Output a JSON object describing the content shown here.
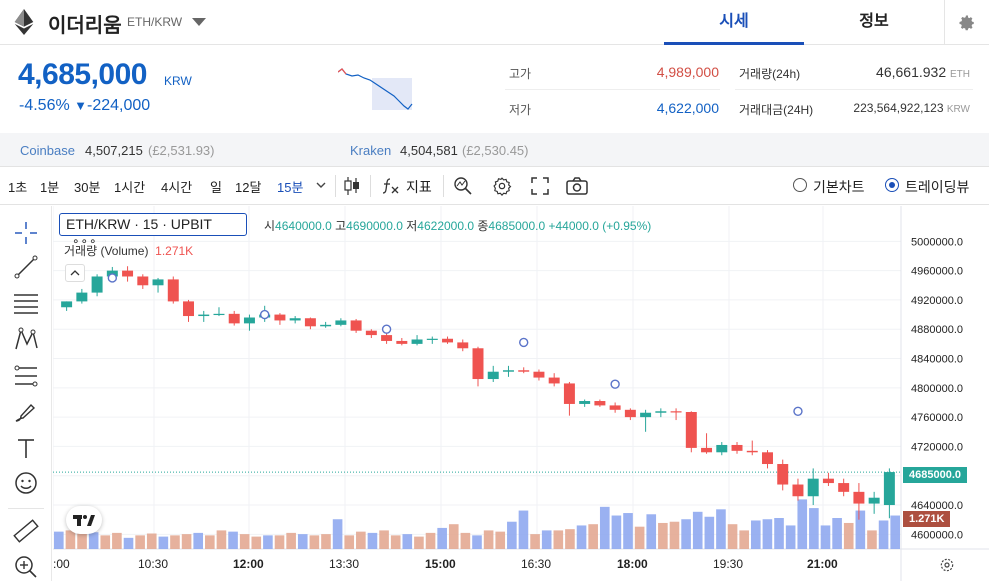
{
  "header": {
    "coin_name": "이더리움",
    "pair": "ETH/KRW",
    "tabs": [
      "시세",
      "정보"
    ]
  },
  "ticker": {
    "price": "4,685,000",
    "currency": "KRW",
    "change_rate": "-4.56%",
    "change_arrow": "▼",
    "change_amount": "-224,000",
    "high_label": "고가",
    "high_value": "4,989,000",
    "low_label": "저가",
    "low_value": "4,622,000",
    "volume_label": "거래량(24h)",
    "volume_value": "46,661.932",
    "volume_unit": "ETH",
    "turnover_label": "거래대금(24H)",
    "turnover_value": "223,564,922,123",
    "turnover_unit": "KRW"
  },
  "exchanges": [
    {
      "name": "Coinbase",
      "price": "4,507,215",
      "sub": "(£2,531.93)"
    },
    {
      "name": "Kraken",
      "price": "4,504,581",
      "sub": "(£2,530.45)"
    }
  ],
  "toolbar": {
    "intervals": [
      "1초",
      "1분",
      "30분",
      "1시간",
      "4시간",
      "일",
      "12달",
      "15분"
    ],
    "indicator_label": "지표",
    "basic_chart": "기본차트",
    "trading_view": "트레이딩뷰"
  },
  "chart_legend": {
    "symbol": "ETH/KRW · 15 · UPBIT",
    "open_label": "시",
    "open": "4640000.0",
    "high_label": "고",
    "high": "4690000.0",
    "low_label": "저",
    "low": "4622000.0",
    "close_label": "종",
    "close": "4685000.0",
    "change": "+44000.0 (+0.95%)",
    "volume_label": "거래량 (Volume)",
    "volume_value": "1.271K",
    "last_price_tag": "4685000.0",
    "volume_tag": "1.271K"
  },
  "colors": {
    "up": "#26a69a",
    "down": "#ef5350",
    "accent": "#1a4fb8",
    "price_blue": "#1261c4",
    "high_red": "#d24f45"
  },
  "chart_data": {
    "type": "candlestick",
    "interval": "15분",
    "y_ticks": [
      "5000000.0",
      "4960000.0",
      "4920000.0",
      "4880000.0",
      "4840000.0",
      "4800000.0",
      "4760000.0",
      "4720000.0",
      "4680000.0",
      "4640000.0",
      "4600000.0"
    ],
    "x_ticks": [
      ":00",
      "10:30",
      "12:00",
      "13:30",
      "15:00",
      "16:30",
      "18:00",
      "19:30",
      "21:00"
    ],
    "ylim": [
      4595000,
      5010000
    ],
    "candles": [
      {
        "o": 4910000,
        "h": 4918000,
        "l": 4905000,
        "c": 4918000
      },
      {
        "o": 4918000,
        "h": 4935000,
        "l": 4915000,
        "c": 4930000
      },
      {
        "o": 4930000,
        "h": 4955000,
        "l": 4925000,
        "c": 4952000
      },
      {
        "o": 4952000,
        "h": 4965000,
        "l": 4945000,
        "c": 4960000
      },
      {
        "o": 4960000,
        "h": 4966000,
        "l": 4945000,
        "c": 4952000
      },
      {
        "o": 4952000,
        "h": 4955000,
        "l": 4935000,
        "c": 4940000
      },
      {
        "o": 4940000,
        "h": 4950000,
        "l": 4930000,
        "c": 4948000
      },
      {
        "o": 4948000,
        "h": 4952000,
        "l": 4915000,
        "c": 4918000
      },
      {
        "o": 4918000,
        "h": 4920000,
        "l": 4890000,
        "c": 4898000
      },
      {
        "o": 4898000,
        "h": 4905000,
        "l": 4890000,
        "c": 4900000
      },
      {
        "o": 4900000,
        "h": 4910000,
        "l": 4898000,
        "c": 4901000
      },
      {
        "o": 4901000,
        "h": 4905000,
        "l": 4885000,
        "c": 4888000
      },
      {
        "o": 4888000,
        "h": 4900000,
        "l": 4878000,
        "c": 4896000
      },
      {
        "o": 4896000,
        "h": 4912000,
        "l": 4890000,
        "c": 4900000
      },
      {
        "o": 4900000,
        "h": 4902000,
        "l": 4886000,
        "c": 4892000
      },
      {
        "o": 4892000,
        "h": 4898000,
        "l": 4888000,
        "c": 4895000
      },
      {
        "o": 4895000,
        "h": 4896000,
        "l": 4880000,
        "c": 4884000
      },
      {
        "o": 4884000,
        "h": 4890000,
        "l": 4882000,
        "c": 4886000
      },
      {
        "o": 4886000,
        "h": 4895000,
        "l": 4884000,
        "c": 4892000
      },
      {
        "o": 4892000,
        "h": 4894000,
        "l": 4875000,
        "c": 4878000
      },
      {
        "o": 4878000,
        "h": 4880000,
        "l": 4868000,
        "c": 4872000
      },
      {
        "o": 4872000,
        "h": 4876000,
        "l": 4860000,
        "c": 4864000
      },
      {
        "o": 4864000,
        "h": 4868000,
        "l": 4858000,
        "c": 4860000
      },
      {
        "o": 4860000,
        "h": 4872000,
        "l": 4858000,
        "c": 4866000
      },
      {
        "o": 4866000,
        "h": 4870000,
        "l": 4860000,
        "c": 4867000
      },
      {
        "o": 4867000,
        "h": 4870000,
        "l": 4860000,
        "c": 4862000
      },
      {
        "o": 4862000,
        "h": 4866000,
        "l": 4850000,
        "c": 4854000
      },
      {
        "o": 4854000,
        "h": 4856000,
        "l": 4802000,
        "c": 4812000
      },
      {
        "o": 4812000,
        "h": 4830000,
        "l": 4808000,
        "c": 4822000
      },
      {
        "o": 4822000,
        "h": 4830000,
        "l": 4815000,
        "c": 4824000
      },
      {
        "o": 4824000,
        "h": 4828000,
        "l": 4820000,
        "c": 4822000
      },
      {
        "o": 4822000,
        "h": 4825000,
        "l": 4810000,
        "c": 4814000
      },
      {
        "o": 4814000,
        "h": 4820000,
        "l": 4802000,
        "c": 4806000
      },
      {
        "o": 4806000,
        "h": 4808000,
        "l": 4762000,
        "c": 4778000
      },
      {
        "o": 4778000,
        "h": 4784000,
        "l": 4774000,
        "c": 4782000
      },
      {
        "o": 4782000,
        "h": 4784000,
        "l": 4774000,
        "c": 4776000
      },
      {
        "o": 4776000,
        "h": 4780000,
        "l": 4766000,
        "c": 4770000
      },
      {
        "o": 4770000,
        "h": 4772000,
        "l": 4756000,
        "c": 4760000
      },
      {
        "o": 4760000,
        "h": 4770000,
        "l": 4740000,
        "c": 4766000
      },
      {
        "o": 4766000,
        "h": 4772000,
        "l": 4760000,
        "c": 4768000
      },
      {
        "o": 4768000,
        "h": 4772000,
        "l": 4756000,
        "c": 4767000
      },
      {
        "o": 4767000,
        "h": 4768000,
        "l": 4712000,
        "c": 4718000
      },
      {
        "o": 4718000,
        "h": 4738000,
        "l": 4710000,
        "c": 4712000
      },
      {
        "o": 4712000,
        "h": 4726000,
        "l": 4708000,
        "c": 4722000
      },
      {
        "o": 4722000,
        "h": 4726000,
        "l": 4710000,
        "c": 4714000
      },
      {
        "o": 4714000,
        "h": 4728000,
        "l": 4708000,
        "c": 4712000
      },
      {
        "o": 4712000,
        "h": 4715000,
        "l": 4690000,
        "c": 4696000
      },
      {
        "o": 4696000,
        "h": 4702000,
        "l": 4660000,
        "c": 4668000
      },
      {
        "o": 4668000,
        "h": 4676000,
        "l": 4646000,
        "c": 4652000
      },
      {
        "o": 4652000,
        "h": 4690000,
        "l": 4640000,
        "c": 4676000
      },
      {
        "o": 4676000,
        "h": 4684000,
        "l": 4666000,
        "c": 4670000
      },
      {
        "o": 4670000,
        "h": 4676000,
        "l": 4652000,
        "c": 4658000
      },
      {
        "o": 4658000,
        "h": 4670000,
        "l": 4620000,
        "c": 4642000
      },
      {
        "o": 4642000,
        "h": 4658000,
        "l": 4628000,
        "c": 4650000
      },
      {
        "o": 4640000,
        "h": 4690000,
        "l": 4622000,
        "c": 4685000
      }
    ],
    "volumes": [
      0.28,
      0.3,
      0.34,
      0.27,
      0.22,
      0.26,
      0.18,
      0.22,
      0.25,
      0.2,
      0.22,
      0.24,
      0.26,
      0.22,
      0.3,
      0.28,
      0.24,
      0.2,
      0.22,
      0.22,
      0.26,
      0.24,
      0.22,
      0.24,
      0.48,
      0.22,
      0.28,
      0.26,
      0.3,
      0.22,
      0.24,
      0.2,
      0.26,
      0.34,
      0.4,
      0.26,
      0.22,
      0.3,
      0.28,
      0.44,
      0.62,
      0.24,
      0.3,
      0.3,
      0.32,
      0.38,
      0.4,
      0.68,
      0.54,
      0.58,
      0.36,
      0.56,
      0.42,
      0.44,
      0.48,
      0.6,
      0.52,
      0.64,
      0.4,
      0.3,
      0.46,
      0.48,
      0.5,
      0.38,
      0.8,
      0.66,
      0.38,
      0.5,
      0.42,
      0.62,
      0.3,
      0.46,
      0.54
    ]
  }
}
